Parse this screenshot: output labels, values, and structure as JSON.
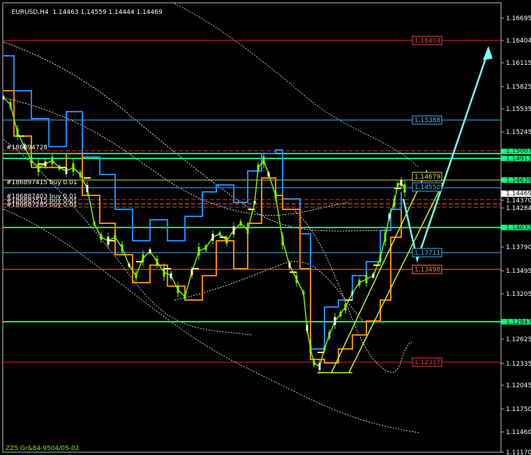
{
  "header": {
    "symbol": "EURUSD,H4",
    "ohlc": "1.14463 1.14559 1.14444 1.14469"
  },
  "colors": {
    "background": "#000000",
    "border": "#c8c8c8",
    "price_candles": "#7cfc00",
    "blue_line": "#1e90ff",
    "orange_line": "#ff8c00",
    "green_level": "#00ff7f",
    "red_level": "#ff2020",
    "arrow": "#7fffff",
    "trend": "#c8ff32"
  },
  "price_axis": {
    "labels": [
      "1.16695",
      "1.16404",
      "1.16115",
      "1.15825",
      "1.15535",
      "1.15245",
      "1.15007",
      "1.14913",
      "1.14639",
      "1.14469",
      "1.14370",
      "1.14284",
      "1.14032",
      "1.13790",
      "1.13495",
      "1.13205",
      "1.12847",
      "1.12625",
      "1.12335",
      "1.12045",
      "1.11750",
      "1.11460",
      "1.11170"
    ]
  },
  "level_tags": [
    {
      "text": "1.16404",
      "color": "#ff4040"
    },
    {
      "text": "1.15388",
      "color": "#40c0ff"
    },
    {
      "text": "1.14679",
      "color": "#e0e040"
    },
    {
      "text": "1.14550",
      "color": "#40c0ff"
    },
    {
      "text": "1.13711",
      "color": "#40c0ff"
    },
    {
      "text": "1.13498",
      "color": "#ff8040"
    },
    {
      "text": "1.12317",
      "color": "#ff4040"
    }
  ],
  "order_labels": [
    "#186894728",
    "#186897415 buy 0.01",
    "#186887403 buy 0.01",
    "#186887515 buy 0.01",
    "#186887285 buy 0.01"
  ],
  "footer": "ZZ5 Gr&84-9504/05-02"
}
